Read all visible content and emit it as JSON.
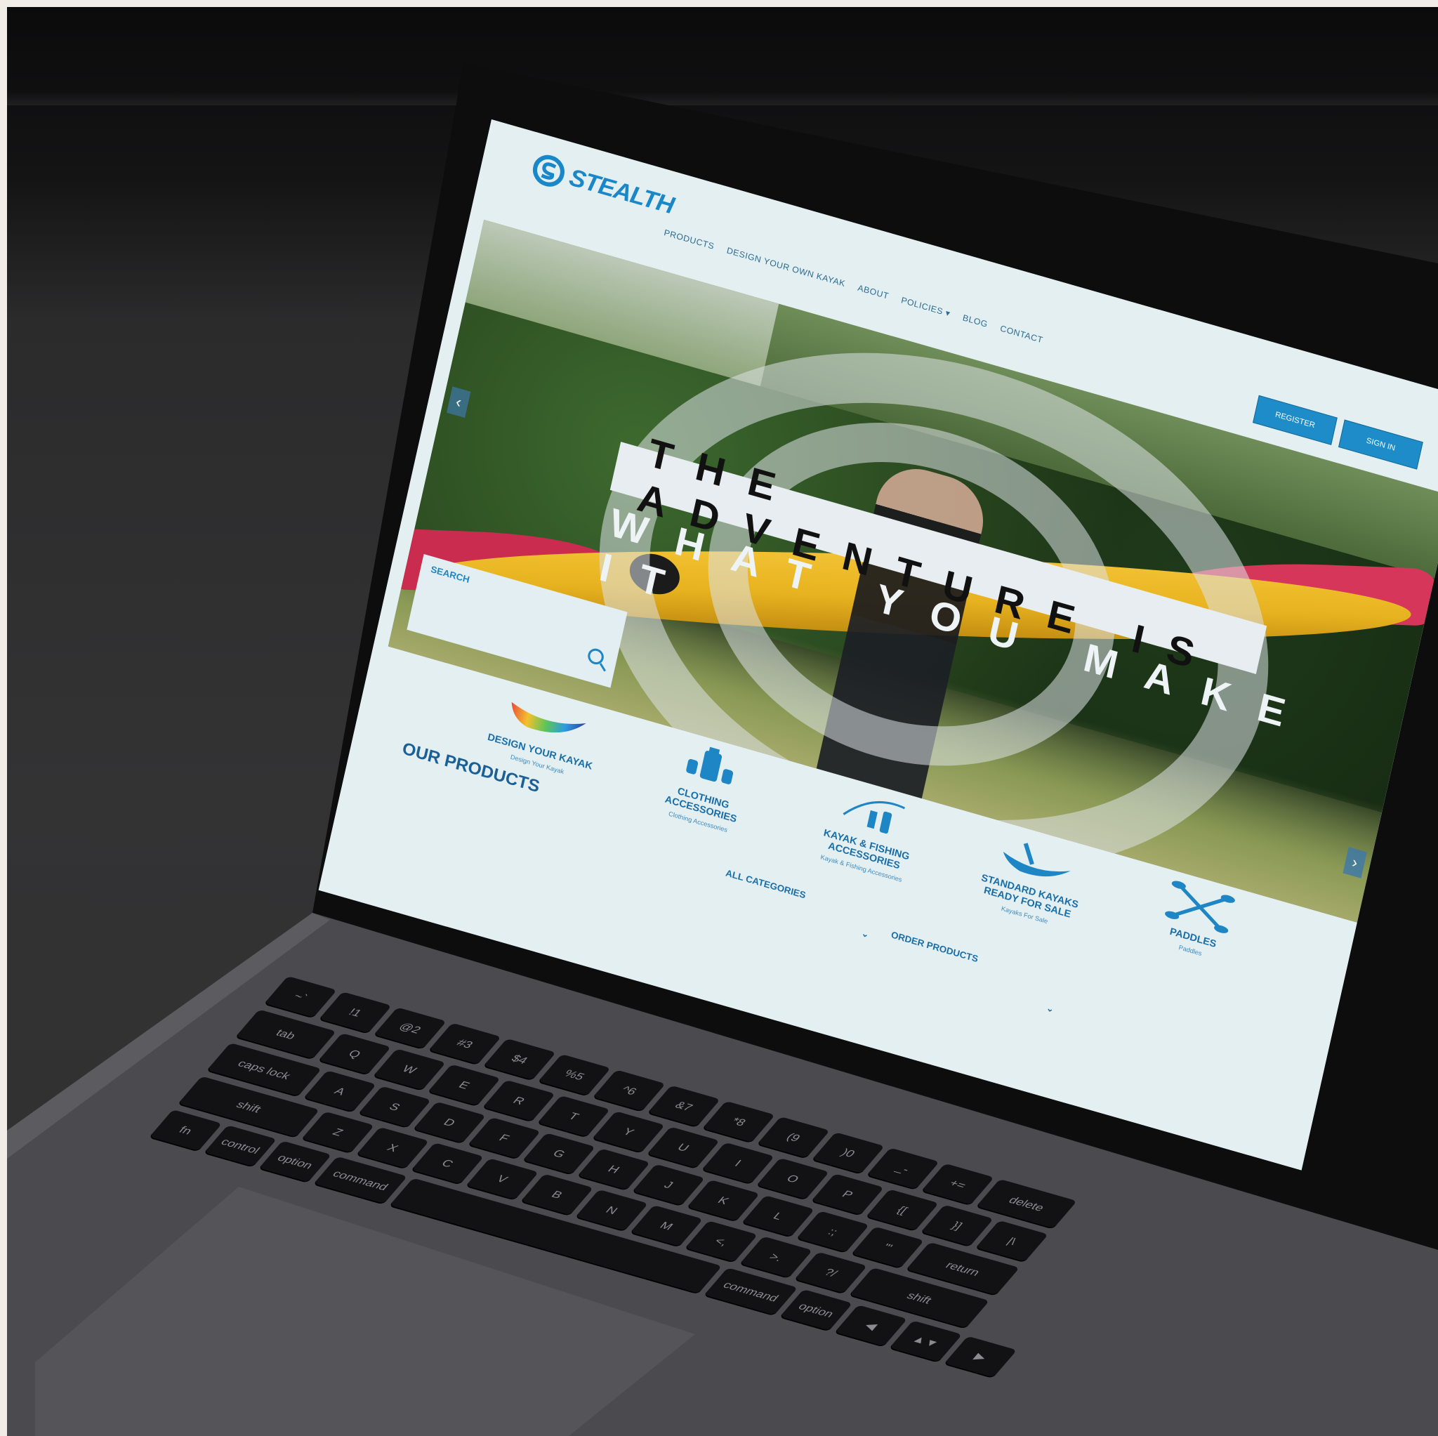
{
  "brand": {
    "name": "STEALTH",
    "accent": "#1e8cc8"
  },
  "nav": {
    "items": [
      {
        "label": "PRODUCTS"
      },
      {
        "label": "DESIGN YOUR OWN KAYAK"
      },
      {
        "label": "ABOUT"
      },
      {
        "label": "POLICIES ▾"
      },
      {
        "label": "BLOG"
      },
      {
        "label": "CONTACT"
      }
    ],
    "register_label": "REGISTER",
    "signin_label": "SIGN IN"
  },
  "hero": {
    "line1": "THE ADVENTURE IS",
    "line2": "WHAT YOU MAKE IT",
    "prev_icon": "chevron-left-icon",
    "next_icon": "chevron-right-icon"
  },
  "search": {
    "label": "SEARCH",
    "icon": "search-icon"
  },
  "categories": [
    {
      "title": "DESIGN YOUR KAYAK",
      "subtitle": "Design Your Kayak",
      "icon": "rainbow-kayak-icon"
    },
    {
      "title": "CLOTHING ACCESSORIES",
      "subtitle": "Clothing Accessories",
      "icon": "clothing-icon"
    },
    {
      "title": "KAYAK & FISHING ACCESSORIES",
      "subtitle": "Kayak & Fishing Accessories",
      "icon": "fishing-rod-icon"
    },
    {
      "title": "STANDARD KAYAKS READY FOR SALE",
      "subtitle": "Kayaks For Sale",
      "icon": "kayak-icon"
    },
    {
      "title": "PADDLES",
      "subtitle": "Paddles",
      "icon": "crossed-paddles-icon"
    }
  ],
  "products": {
    "heading": "OUR PRODUCTS",
    "all_categories": "ALL CATEGORIES",
    "order_products": "ORDER PRODUCTS"
  },
  "keyboard": {
    "rows": [
      [
        "~`",
        "!1",
        "@2",
        "#3",
        "$4",
        "%5",
        "^6",
        "&7",
        "*8",
        "(9",
        ")0",
        "_-",
        "+=",
        "delete"
      ],
      [
        "tab",
        "Q",
        "W",
        "E",
        "R",
        "T",
        "Y",
        "U",
        "I",
        "O",
        "P",
        "{[",
        "}]",
        "|\\"
      ],
      [
        "caps lock",
        "A",
        "S",
        "D",
        "F",
        "G",
        "H",
        "J",
        "K",
        "L",
        ":;",
        "\"'",
        "return"
      ],
      [
        "shift",
        "Z",
        "X",
        "C",
        "V",
        "B",
        "N",
        "M",
        "<,",
        ">.",
        "?/",
        "shift"
      ],
      [
        "fn",
        "control",
        "option",
        "command",
        " ",
        "command",
        "option",
        "◀",
        "▲▼",
        "▶"
      ]
    ]
  }
}
